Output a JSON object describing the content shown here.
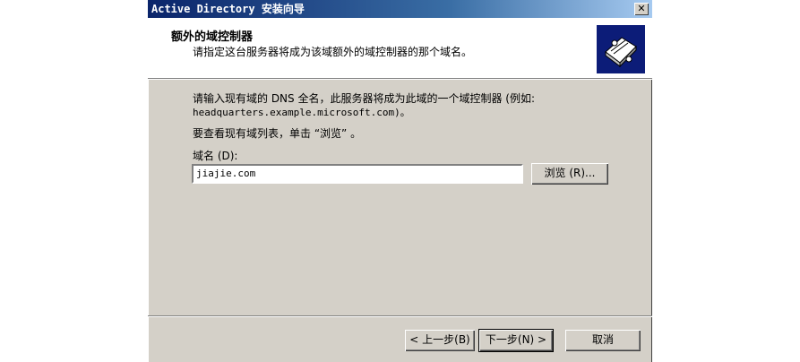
{
  "window": {
    "title": "Active Directory 安装向导",
    "close_glyph": "✕"
  },
  "header": {
    "title": "额外的域控制器",
    "subtitle": "请指定这台服务器将成为该域额外的域控制器的那个域名。",
    "icon": "directory-book-icon"
  },
  "body": {
    "instruction_line1": "请输入现有域的 DNS 全名，此服务器将成为此域的一个域控制器 (例如:",
    "instruction_line2": "headquarters.example.microsoft.com)。",
    "browse_hint": "要查看现有域列表，单击 “浏览” 。",
    "domain_label": "域名 (D):",
    "domain_value": "jiajie.com",
    "browse_button": "浏览 (R)..."
  },
  "footer": {
    "back_button": "< 上一步(B)",
    "next_button": "下一步(N) >",
    "cancel_button": "取消"
  }
}
